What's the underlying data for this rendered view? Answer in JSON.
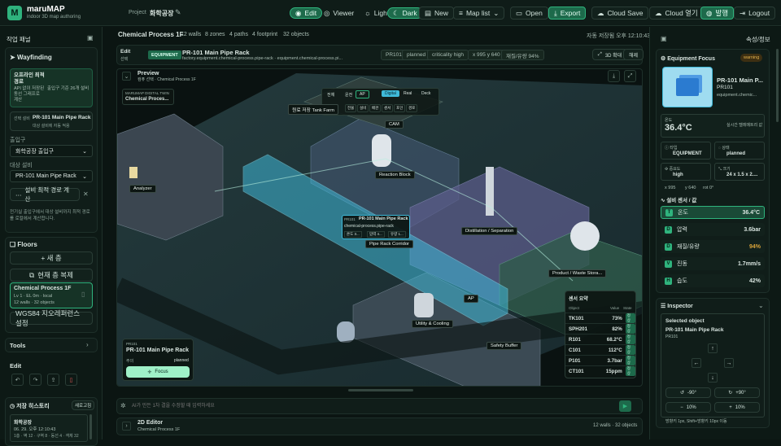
{
  "app": {
    "logo_letter": "M",
    "name": "maruMAP",
    "tagline": "indoor 3D map authoring",
    "project_label": "Project",
    "project_name": "화학공장"
  },
  "topbar": {
    "edit": "Edit",
    "viewer": "Viewer",
    "light": "Light",
    "dark": "Dark",
    "new": "New",
    "map_list": "Map list",
    "open": "Open",
    "export": "Export",
    "cloud_save": "Cloud Save",
    "cloud_open": "Cloud 열기",
    "publish": "발행",
    "logout": "Logout"
  },
  "left": {
    "title": "작업 패널",
    "wayfinding": "Wayfinding",
    "route_title": "오프라인 최적 경로",
    "route_desc": "API 없이 저장된 동선 그래프로 계산",
    "route_note": "출입구 기준 26개 설비",
    "target_label": "선택 설비",
    "target_name": "PR-101 Main Pipe Rack",
    "target_sub": "대상 설비에 자동 적용",
    "entrance_label": "출입구",
    "entrance_value": "화학공장 출입구",
    "equipment_label": "대상 설비",
    "equipment_value": "PR-101 Main Pipe Rack",
    "calc_button": "설비 최적 경로 계산",
    "help": "전기실 출입구에서 대상 설비까지 최적 경로를 로컬에서 계산합니다.",
    "floors": "Floors",
    "new_floor": "+ 새 층",
    "copy_floor": "현재 층 복제",
    "floor_name": "Chemical Process 1F",
    "floor_meta1": "Lv 1 · EL 0m · local",
    "floor_meta2": "12 walls · 32 objects",
    "wgs": "WGS84 지오레퍼런스 설정",
    "tools": "Tools",
    "edit": "Edit",
    "history": "저장 히스토리",
    "history_btn": "새로고침",
    "hist_item": "화학공장",
    "hist_date": "06. 29. 오후 12:10:43",
    "hist_meta": "1층 · 벽 12 · 구역 8 · 동선 4 · 객체 32"
  },
  "center": {
    "floor": "Chemical Process 1F",
    "stats": [
      "12 walls",
      "8 zones",
      "4 paths",
      "4 footprint",
      "32 objects"
    ],
    "autosave": "자동 저장됨 오후 12:10:43",
    "edit_sel": "Edit",
    "edit_sel2": "선택",
    "badge": "EQUIPMENT",
    "item_name": "PR-101 Main Pipe Rack",
    "item_path": "factory.equipment.chemical-process.pipe-rack · equipment.chemical-process.pi...",
    "tags": [
      "PR101",
      "planned",
      "criticality high",
      "x 995 y 640",
      "재질/유량 94%"
    ],
    "zoom3d": "3D 확대",
    "release": "해제",
    "preview": "Preview",
    "preview_sub": "컴퓨 선택 · Chemical Process 1F",
    "twin_brand": "MARUMAP DIGITAL TWIN",
    "twin_title": "Chemical Proces...",
    "view_modes": [
      "전체",
      "운전",
      "AP"
    ],
    "modes2": [
      "Digital",
      "Real",
      "Deck"
    ],
    "filters": [
      "전물",
      "설비",
      "배관",
      "센서",
      "포인",
      "경로"
    ],
    "labels": {
      "tank": "원료 저장 Tank Farm",
      "cam": "CAM",
      "reaction": "Reaction Block",
      "analyzer": "Analyzer",
      "pipe": "Pipe Rack Corridor",
      "distill": "Distillation / Separation",
      "product": "Product / Waste Stora...",
      "utility": "Utility & Cooling",
      "safety": "Safety Buffer",
      "ap": "AP"
    },
    "popup": {
      "id": "PR101",
      "name": "PR-101 Main Pipe Rack",
      "path": "chemical-process.pipe-rack",
      "f1": "온도 3...",
      "f2": "압력 4...",
      "f3": "유량 1..."
    },
    "focus": {
      "id": "PR101",
      "name": "PR-101 Main Pipe Rack",
      "k": "주의",
      "v": "planned",
      "btn": "Focus"
    },
    "sensor_title": "센서 요약",
    "sensor_head": [
      "Object",
      "Value",
      "State"
    ],
    "sensors": [
      {
        "id": "TK101",
        "val": "73%",
        "st": "정상"
      },
      {
        "id": "SPH201",
        "val": "82%",
        "st": "정상"
      },
      {
        "id": "R101",
        "val": "68.2°C",
        "st": "정상"
      },
      {
        "id": "C101",
        "val": "112°C",
        "st": "정상"
      },
      {
        "id": "P101",
        "val": "3.7bar",
        "st": "정상"
      },
      {
        "id": "CT101",
        "val": "15ppm",
        "st": "정상"
      }
    ],
    "ai_placeholder": "AI가 만든 1차 결을 수정할 때 입력하세요",
    "editor": "2D Editor",
    "editor_sub": "Chemical Process 1F",
    "editor_stats": "12 walls · 32 objects"
  },
  "right": {
    "title": "속성/정보",
    "focus_title": "Equipment Focus",
    "warn": "warning",
    "name": "PR-101 Main P...",
    "id": "PR101",
    "path": "equipment.chemic...",
    "temp_label": "온도",
    "temp": "36.4°C",
    "temp_note": "실시간 텔레메트리 값",
    "type_k": "타입",
    "type_v": "EQUIPMENT",
    "state_k": "상태",
    "state_v": "planned",
    "crit_k": "중요도",
    "crit_v": "high",
    "size_k": "크기",
    "size_v": "24 x 1.5 x 2....",
    "coords": [
      "x 995",
      "y 640",
      "rot 0°"
    ],
    "sensor_title": "설비 센서 / 값",
    "sensors": [
      {
        "icon": "T",
        "name": "온도",
        "val": "36.4°C"
      },
      {
        "icon": "D",
        "name": "압력",
        "val": "3.6bar"
      },
      {
        "icon": "D",
        "name": "재질/유량",
        "val": "94%"
      },
      {
        "icon": "V",
        "name": "진동",
        "val": "1.7mm/s"
      },
      {
        "icon": "H",
        "name": "습도",
        "val": "42%"
      }
    ],
    "inspector": "Inspector",
    "selected": "Selected object",
    "sel_name": "PR-101 Main Pipe Rack",
    "sel_id": "PR101",
    "rot_minus": "-90°",
    "rot_plus": "+90°",
    "scale_minus": "10%",
    "scale_plus": "10%",
    "hint": "방향키 1px, Shift+방향키 10px 이동"
  },
  "colors": {
    "accent": "#2fb37d",
    "bg": "#0b1512",
    "warn": "#d9a43a"
  }
}
